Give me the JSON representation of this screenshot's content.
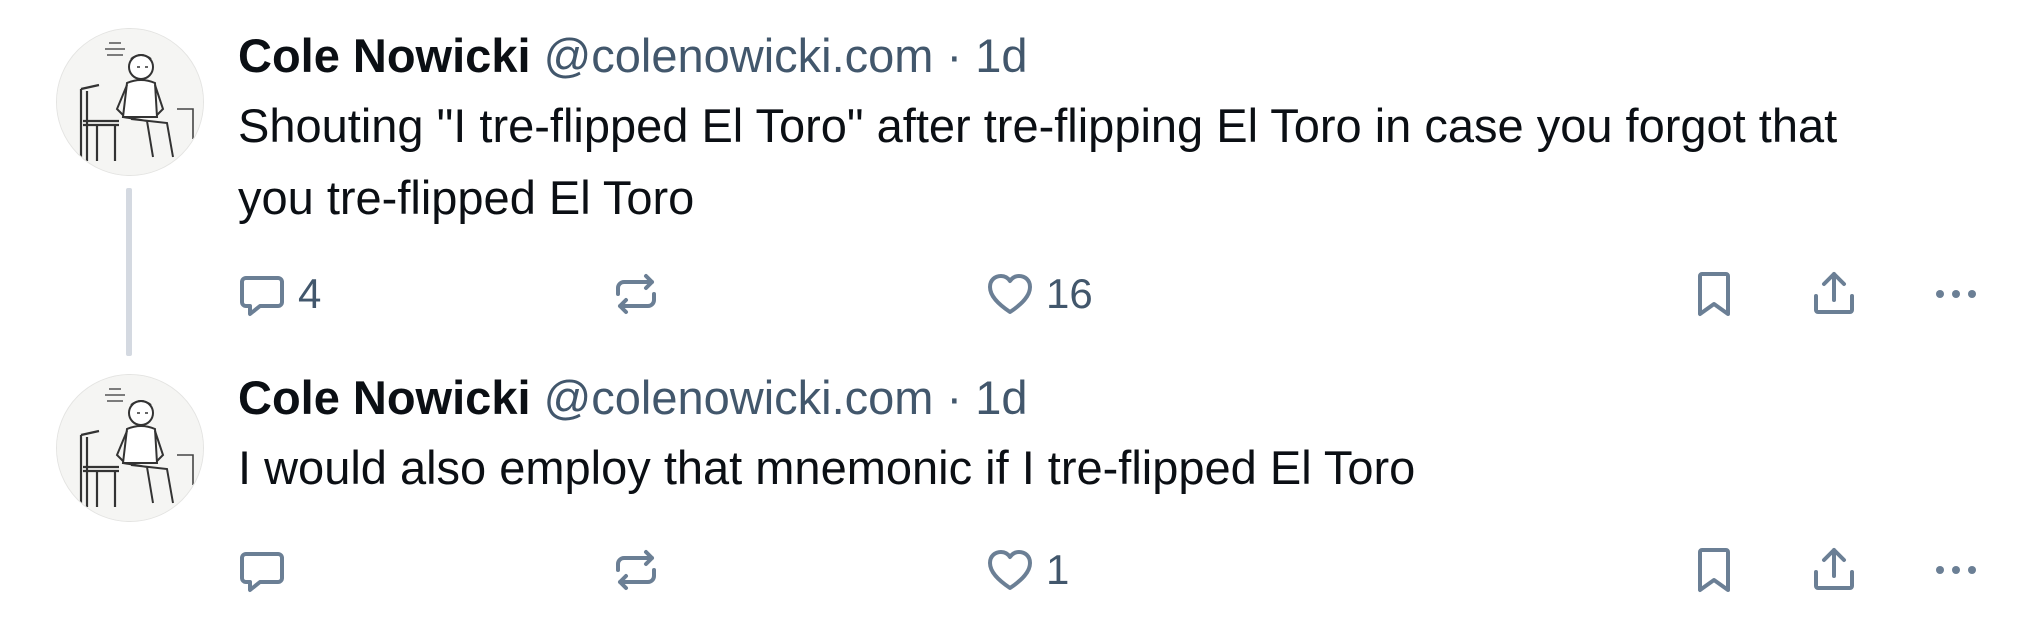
{
  "posts": [
    {
      "author": "Cole Nowicki",
      "handle": "@colenowicki.com",
      "separator": "·",
      "time": "1d",
      "text": "Shouting \"I tre-flipped El Toro\" after tre-flipping El Toro in case you forgot that you tre-flipped El Toro",
      "reply_count": "4",
      "repost_count": "",
      "like_count": "16"
    },
    {
      "author": "Cole Nowicki",
      "handle": "@colenowicki.com",
      "separator": "·",
      "time": "1d",
      "text": "I would also employ that mnemonic if I tre-flipped El Toro",
      "reply_count": "",
      "repost_count": "",
      "like_count": "1"
    }
  ],
  "icons": {
    "reply": "speech-bubble-icon",
    "repost": "repost-arrows-icon",
    "like": "heart-icon",
    "bookmark": "bookmark-icon",
    "share": "share-icon",
    "more": "more-dots-icon"
  },
  "colors": {
    "text": "#0b0f14",
    "muted": "#42576c",
    "icon": "#6b7f95",
    "thread_line": "#d4d9e1"
  }
}
